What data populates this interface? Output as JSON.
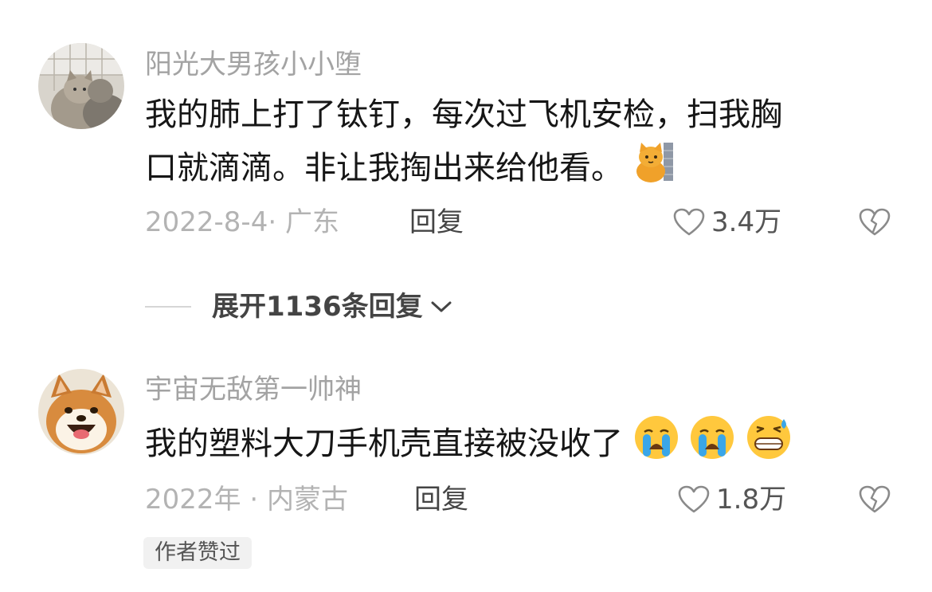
{
  "comments": [
    {
      "username": "阳光大男孩小小堕",
      "text_line1": "我的肺上打了钛钉，每次过飞机安检，扫我胸",
      "text_line2": "口就滴滴。非让我掏出来给他看。",
      "meta": "2022-8-4· 广东",
      "reply_label": "回复",
      "likes": "3.4万",
      "avatar_icon": "cat-avatar",
      "emoji_icons": [
        "cat-behind-wall-emoji"
      ]
    },
    {
      "username": "宇宙无敌第一帅神",
      "text": "我的塑料大刀手机壳直接被没收了",
      "meta": "2022年 · 内蒙古",
      "reply_label": "回复",
      "likes": "1.8万",
      "author_badge": "作者赞过",
      "avatar_icon": "shiba-dog-avatar",
      "emoji_icons": [
        "crying-face-emoji",
        "crying-face-emoji",
        "grinning-sweat-emoji"
      ]
    }
  ],
  "expand_replies": {
    "label": "展开1136条回复"
  },
  "colors": {
    "username": "#a3a3a3",
    "text": "#161616",
    "meta": "#b3b3b3",
    "emoji_yellow": "#ffc83d",
    "emoji_tear": "#3aa6e8"
  }
}
